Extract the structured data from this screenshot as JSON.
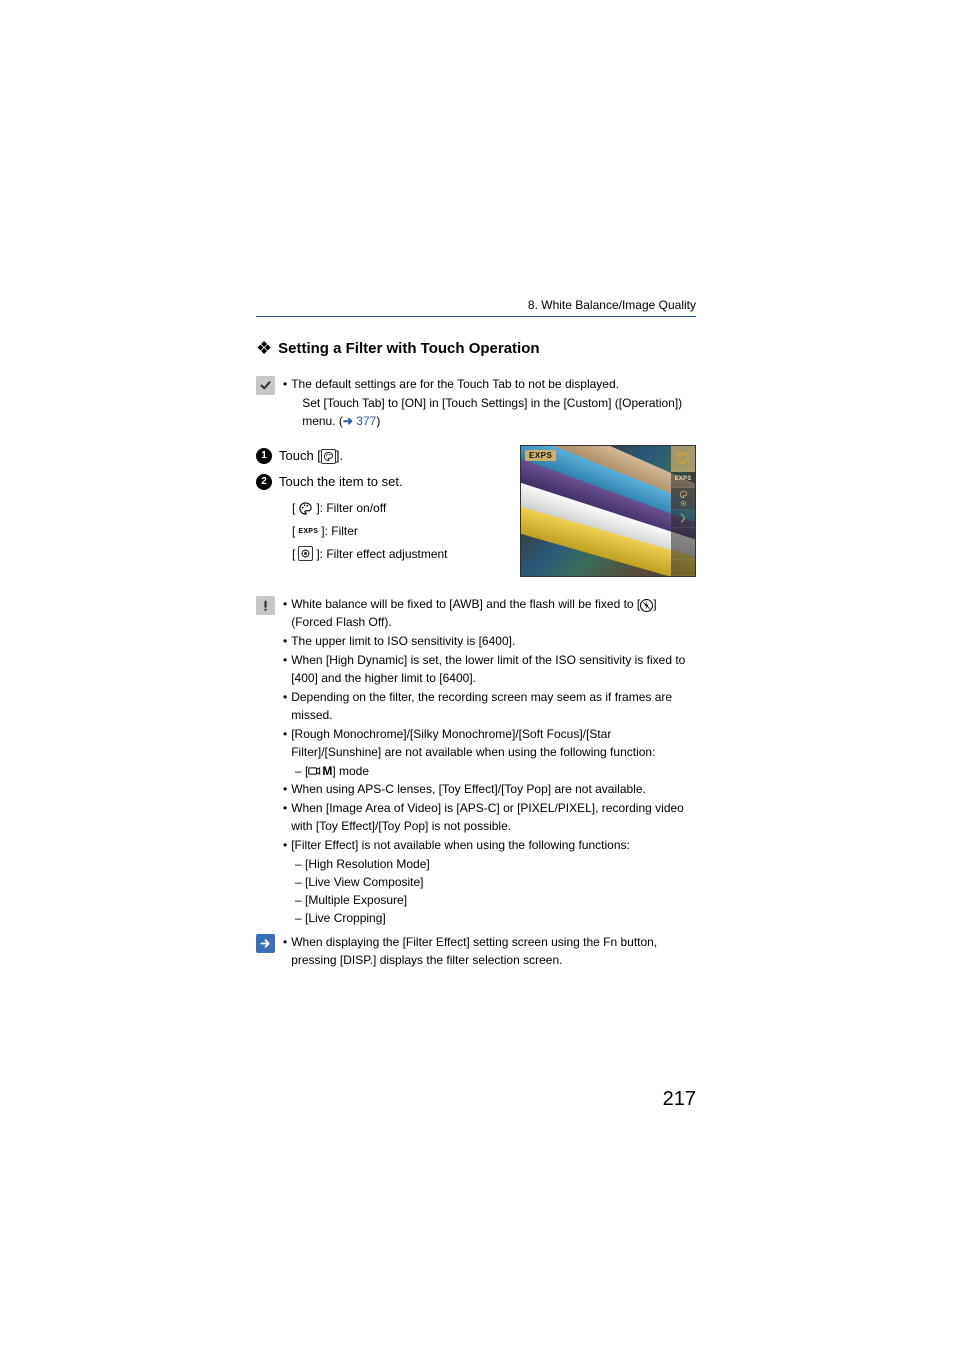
{
  "breadcrumb": "8. White Balance/Image Quality",
  "section_title": "Setting a Filter with Touch Operation",
  "note1": {
    "line1": "The default settings are for the Touch Tab to not be displayed.",
    "line2a": "Set [Touch Tab] to [ON] in [Touch Settings] in the [Custom] ([Operation]) ",
    "line2b": "menu. (",
    "link": "377",
    "line2c": ")"
  },
  "steps": {
    "s1a": "Touch [",
    "s1b": "].",
    "s2": "Touch the item to set."
  },
  "sub": {
    "l1a": "[ ",
    "l1b": " ]: Filter on/off",
    "l2a": "[ ",
    "l2label": "EXPS",
    "l2b": " ]: Filter",
    "l3a": "[ ",
    "l3b": " ]: Filter effect adjustment"
  },
  "preview": {
    "overlay": "EXPS",
    "tab2": "EXPS"
  },
  "long": {
    "i1a": "White balance will be fixed to [AWB] and the flash will be fixed to [",
    "i1b": "] (Forced Flash Off).",
    "i2": "The upper limit to ISO sensitivity is [6400].",
    "i3": "When [High Dynamic] is set, the lower limit of the ISO sensitivity is fixed to [400] and the higher limit to [6400].",
    "i4": "Depending on the filter, the recording screen may seem as if frames are missed.",
    "i5": "[Rough Monochrome]/[Silky Monochrome]/[Soft Focus]/[Star Filter]/[Sunshine] are not available when using the following function:",
    "i5s1b": "] mode",
    "i6": "When using APS-C lenses, [Toy Effect]/[Toy Pop] are not available.",
    "i7": "When [Image Area of Video] is [APS-C] or [PIXEL/PIXEL], recording video with [Toy Effect]/[Toy Pop] is not possible.",
    "i8": "[Filter Effect] is not available when using the following functions:",
    "i8s1": "– [High Resolution Mode]",
    "i8s2": "– [Live View Composite]",
    "i8s3": "– [Multiple Exposure]",
    "i8s4": "– [Live Cropping]"
  },
  "tip": {
    "t1": "When displaying the [Filter Effect] setting screen using the Fn button, pressing [DISP.] displays the filter selection screen."
  },
  "page": "217",
  "dash": "– [",
  "bullet": "•"
}
